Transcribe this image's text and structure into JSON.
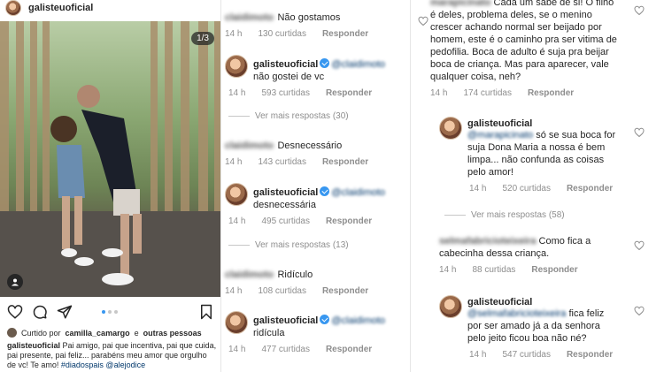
{
  "post": {
    "username": "galisteuoficial",
    "photo_counter": "1/3",
    "liked_prefix": "Curtido por",
    "liked_user": "camilla_camargo",
    "liked_and": "e",
    "liked_others": "outras pessoas",
    "caption_user": "galisteuoficial",
    "caption_text": "Pai amigo, pai que incentiva, pai que cuida, pai presente, pai  feliz... parabéns meu amor que orgulho de vc! Te amo!",
    "caption_tags": "#diadospais  @alejodice"
  },
  "comments_mid": [
    {
      "user": "claidimoto",
      "text": "Não gostamos",
      "time": "14 h",
      "likes": "130 curtidas",
      "reply": "Responder"
    },
    {
      "user": "galisteuoficial",
      "mention": "@claidimoto",
      "text": "não gostei de vc",
      "time": "14 h",
      "likes": "593 curtidas",
      "reply": "Responder"
    },
    {
      "view_more": "Ver mais respostas (30)"
    },
    {
      "user": "claidimoto",
      "text": "Desnecessário",
      "time": "14 h",
      "likes": "143 curtidas",
      "reply": "Responder"
    },
    {
      "user": "galisteuoficial",
      "mention": "@claidimoto",
      "text": "desnecessária",
      "time": "14 h",
      "likes": "495 curtidas",
      "reply": "Responder"
    },
    {
      "view_more": "Ver mais respostas (13)"
    },
    {
      "user": "claidimoto",
      "text": "Ridículo",
      "time": "14 h",
      "likes": "108 curtidas",
      "reply": "Responder"
    },
    {
      "user": "galisteuoficial",
      "mention": "@claidimoto",
      "text": "ridícula",
      "time": "14 h",
      "likes": "477 curtidas",
      "reply": "Responder"
    }
  ],
  "comments_right": [
    {
      "user": "marapicinato",
      "text": "Cada um sabe de si! O filho é deles, problema deles, se o menino crescer achando normal ser beijado por homem, este é o caminho pra ser vitima de pedofilia. Boca de adulto é suja pra beijar boca de criança. Mas para aparecer, vale qualquer coisa, neh?",
      "time": "14 h",
      "likes": "174 curtidas",
      "reply": "Responder"
    },
    {
      "user": "galisteuoficial",
      "mention": "@marapicinato",
      "text": "só se sua boca for suja Dona Maria a nossa é bem limpa... não confunda as coisas pelo amor!",
      "time": "14 h",
      "likes": "520 curtidas",
      "reply": "Responder"
    },
    {
      "view_more": "Ver mais respostas (58)"
    },
    {
      "user": "selmafabricioteixeira",
      "text": "Como fica a cabecinha dessa criança.",
      "time": "14 h",
      "likes": "88 curtidas",
      "reply": "Responder"
    },
    {
      "user": "galisteuoficial",
      "mention": "@selmafabricioteixeira",
      "text": "fica feliz por ser amado já a da senhora pelo jeito ficou boa não né?",
      "time": "14 h",
      "likes": "547 curtidas",
      "reply": "Responder"
    }
  ],
  "icons": [
    "heart-icon",
    "comment-icon",
    "share-icon",
    "bookmark-icon",
    "tag-icon",
    "verified-icon"
  ],
  "colors": {
    "link": "#00376b",
    "verified": "#3897f0",
    "muted": "#8e8e8e"
  }
}
